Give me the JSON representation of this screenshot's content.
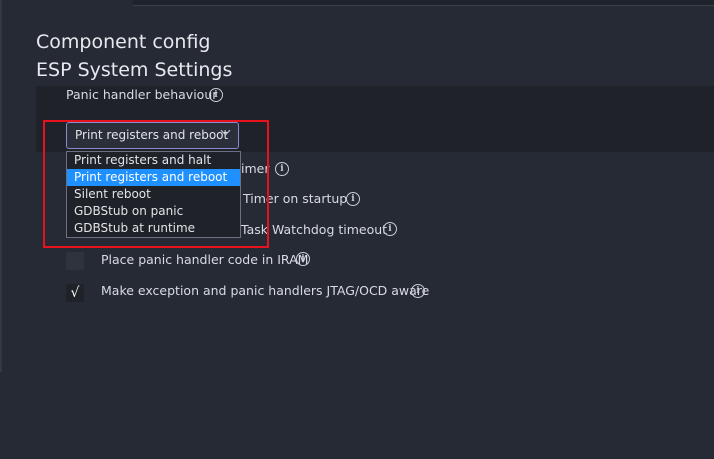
{
  "header": {
    "title": "Component config",
    "subtitle": "ESP System Settings"
  },
  "field": {
    "label": "Panic handler behaviour",
    "selected_value": "Print registers and reboot",
    "options": [
      "Print registers and halt",
      "Print registers and reboot",
      "Silent reboot",
      "GDBStub on panic",
      "GDBStub at runtime"
    ],
    "selected_index": 1
  },
  "settings": {
    "row1_partial": "imer",
    "row2_partial": "Timer on startup",
    "row3_partial": "Task Watchdog timeout",
    "iram_label": "Place panic handler code in IRAM",
    "jtag_label": "Make exception and panic handlers JTAG/OCD aware",
    "jtag_checked_glyph": "√"
  },
  "colors": {
    "background": "#262a34",
    "selected_option": "#1e90ff",
    "highlight_box": "#e8121c",
    "select_border": "#8a8cd0"
  },
  "icons": {
    "info": "info-icon",
    "dropdown": "chevron-down-icon",
    "check": "check-icon"
  }
}
